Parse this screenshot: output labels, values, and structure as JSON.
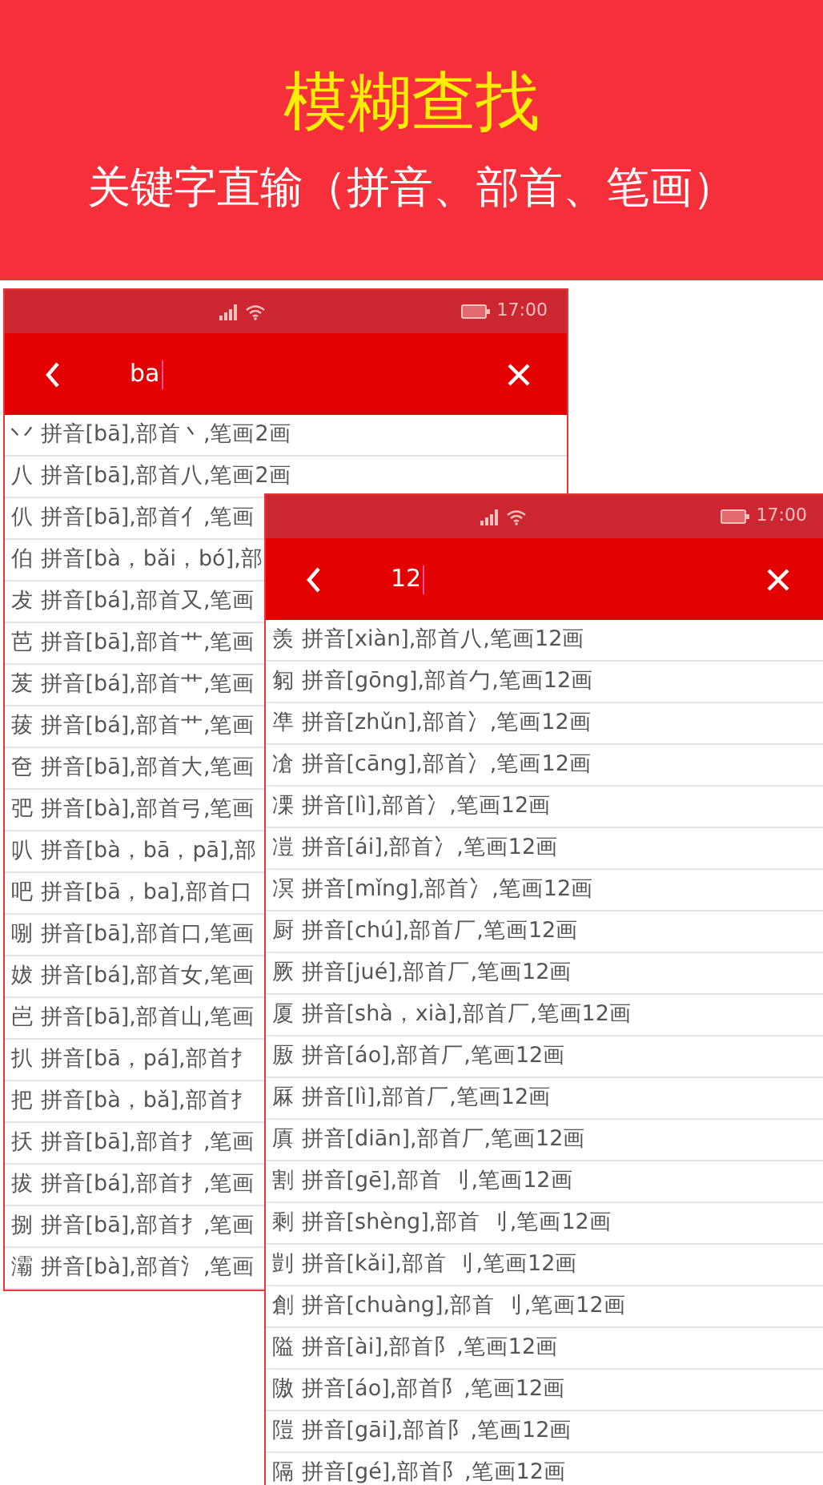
{
  "banner": {
    "title": "模糊查找",
    "subtitle": "关键字直输（拼音、部首、笔画）"
  },
  "phones": [
    {
      "status_time": "17:00",
      "search_value": "ba",
      "results": [
        "丷 拼音[bā],部首丶,笔画2画",
        "八 拼音[bā],部首八,笔画2画",
        "仈 拼音[bā],部首亻,笔画",
        "伯 拼音[bà，bǎi，bó],部",
        "犮 拼音[bá],部首又,笔画",
        "芭 拼音[bā],部首艹,笔画",
        "茇 拼音[bá],部首艹,笔画",
        "菝 拼音[bá],部首艹,笔画",
        "夿 拼音[bā],部首大,笔画",
        "弝 拼音[bà],部首弓,笔画",
        "叭 拼音[bà，bā，pā],部",
        "吧 拼音[bā，ba],部首口",
        "哵 拼音[bā],部首口,笔画",
        "妭 拼音[bá],部首女,笔画",
        "岜 拼音[bā],部首山,笔画",
        "扒 拼音[bā，pá],部首扌",
        "把 拼音[bà，bǎ],部首扌",
        "扷 拼音[bā],部首扌,笔画",
        "拔 拼音[bá],部首扌,笔画",
        "捌 拼音[bā],部首扌,笔画",
        "灞 拼音[bà],部首氵,笔画"
      ]
    },
    {
      "status_time": "17:00",
      "search_value": "12",
      "results": [
        "羡 拼音[xiàn],部首八,笔画12画",
        "匑 拼音[gōng],部首勹,笔画12画",
        "凖 拼音[zhǔn],部首冫,笔画12画",
        "凔 拼音[cāng],部首冫,笔画12画",
        "凓 拼音[lì],部首冫,笔画12画",
        "凒 拼音[ái],部首冫,笔画12画",
        "凕 拼音[mǐng],部首冫,笔画12画",
        "厨 拼音[chú],部首厂,笔画12画",
        "厥 拼音[jué],部首厂,笔画12画",
        "厦 拼音[shà，xià],部首厂,笔画12画",
        "厫 拼音[áo],部首厂,笔画12画",
        "厤 拼音[lì],部首厂,笔画12画",
        "厧 拼音[diān],部首厂,笔画12画",
        "割 拼音[gē],部首 刂,笔画12画",
        "剩 拼音[shèng],部首 刂,笔画12画",
        "剴 拼音[kǎi],部首 刂,笔画12画",
        "創 拼音[chuàng],部首 刂,笔画12画",
        "隘 拼音[ài],部首阝,笔画12画",
        "隞 拼音[áo],部首阝,笔画12画",
        "隑 拼音[gāi],部首阝,笔画12画",
        "隔 拼音[gé],部首阝,笔画12画"
      ]
    }
  ]
}
